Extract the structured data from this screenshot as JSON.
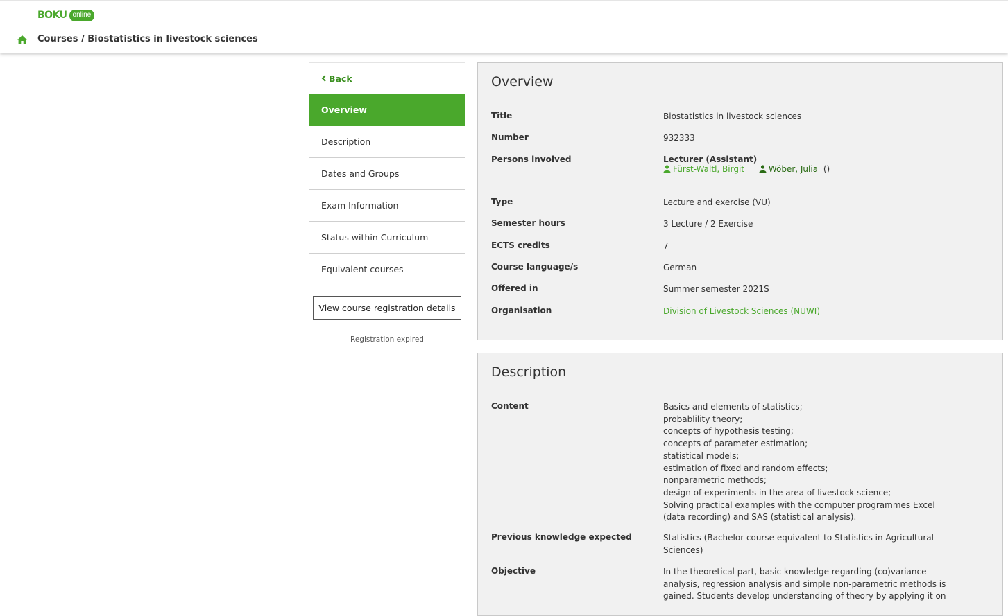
{
  "header": {
    "logo_boku": "BOKU",
    "logo_online": "online",
    "breadcrumb": "Courses / Biostatistics in livestock sciences"
  },
  "sidenav": {
    "back_label": "Back",
    "items": [
      {
        "label": "Overview",
        "active": true
      },
      {
        "label": "Description"
      },
      {
        "label": "Dates and Groups"
      },
      {
        "label": "Exam Information"
      },
      {
        "label": "Status within Curriculum"
      },
      {
        "label": "Equivalent courses"
      }
    ],
    "registration_button": "View course registration details",
    "registration_status": "Registration expired"
  },
  "overview": {
    "heading": "Overview",
    "rows": {
      "title": {
        "label": "Title",
        "value": "Biostatistics in livestock sciences"
      },
      "number": {
        "label": "Number",
        "value": "932333"
      },
      "persons": {
        "label": "Persons involved",
        "role": "Lecturer (Assistant)",
        "person1": "Fürst-Waltl, Birgit",
        "person2": "Wöber, Julia",
        "person2_suffix": "()"
      },
      "type": {
        "label": "Type",
        "value": "Lecture and exercise (VU)"
      },
      "semester_hours": {
        "label": "Semester hours",
        "value": "3 Lecture / 2 Exercise"
      },
      "ects": {
        "label": "ECTS credits",
        "value": "7"
      },
      "language": {
        "label": "Course language/s",
        "value": "German"
      },
      "offered": {
        "label": "Offered in",
        "value": "Summer semester 2021S"
      },
      "organisation": {
        "label": "Organisation",
        "value": "Division of Livestock Sciences (NUWI)"
      }
    }
  },
  "description": {
    "heading": "Description",
    "content_label": "Content",
    "content_lines": [
      "Basics and elements of statistics;",
      "probablility theory;",
      "concepts of hypothesis testing;",
      "concepts of parameter estimation;",
      "statistical models;",
      "estimation of fixed and random effects;",
      "nonparametric methods;",
      "design of experiments in the area of livestock science;",
      "Solving practical examples with the computer programmes Excel",
      "(data recording) and SAS (statistical analysis)."
    ],
    "prev_label": "Previous knowledge expected",
    "prev_lines": [
      "Statistics (Bachelor course equivalent to Statistics in Agricultural",
      "Sciences)"
    ],
    "objective_label": "Objective",
    "objective_lines": [
      "In the theoretical part, basic knowledge regarding (co)variance",
      "analysis, regression analysis and simple non-parametric methods is",
      "gained. Students develop understanding of theory by applying it on"
    ]
  },
  "colors": {
    "brand_green": "#4aa82c",
    "link_dark_green": "#2a6b14",
    "panel_bg": "#f1f1f1"
  }
}
